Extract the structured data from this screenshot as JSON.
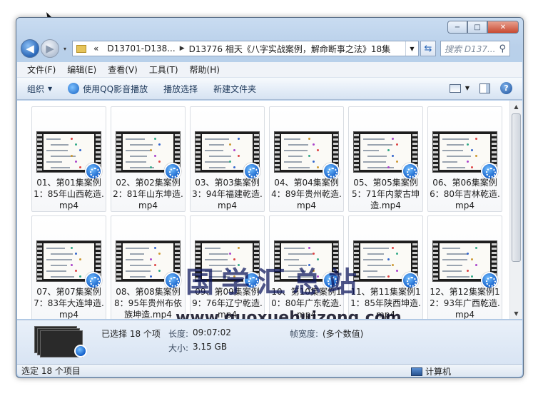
{
  "window": {
    "caption_min": "−",
    "caption_max": "□",
    "caption_close": "✕"
  },
  "nav": {
    "back_glyph": "◀",
    "forward_glyph": "▶",
    "history_glyph": "▾",
    "breadcrumb_prefix": "«",
    "crumb_1": "D13701-D138...",
    "crumb_sep": "▶",
    "crumb_2": "D13776 相天《八字实战案例，解命断事之法》18集",
    "address_dropdown": "▼",
    "refresh_glyph": "⇆",
    "search_placeholder": "搜索 D137...",
    "search_icon": "magnifier-icon"
  },
  "menu": [
    "文件(F)",
    "编辑(E)",
    "查看(V)",
    "工具(T)",
    "帮助(H)"
  ],
  "toolbar": {
    "organize": "组织",
    "play_with_qq": "使用QQ影音播放",
    "play_selection": "播放选择",
    "new_folder": "新建文件夹",
    "help_glyph": "?"
  },
  "files": [
    "01、第01集案例1：85年山西乾造.mp4",
    "02、第02集案例2：81年山东坤造.mp4",
    "03、第03集案例3：94年福建乾造.mp4",
    "04、第04集案例4：89年贵州乾造.mp4",
    "05、第05集案例5：71年内蒙古坤造.mp4",
    "06、第06集案例6：80年吉林乾造.mp4",
    "07、第07集案例7：83年大连坤造.mp4",
    "08、第08集案例8：95年贵州布依族坤造.mp4",
    "09、第09集案例9：76年辽宁乾造.mp4",
    "10、第10集案例10：80年广东乾造.mp4",
    "11、第11集案例11：85年陕西坤造.mp4",
    "12、第12集案例12：93年广西乾造.mp4"
  ],
  "watermark": {
    "cn": "国学汇总站",
    "en": "www.guoxuehuizong.com"
  },
  "details": {
    "selected": "已选择 18 个项",
    "length_label": "长度:",
    "length_value": "09:07:02",
    "size_label": "大小:",
    "size_value": "3.15 GB",
    "frame_width_label": "帧宽度:",
    "frame_width_value": "(多个数值)"
  },
  "status": {
    "left": "选定 18 个项目",
    "computer": "计算机"
  },
  "colors": {
    "accent": "#2a67b8",
    "badge": "#0b58c6"
  }
}
